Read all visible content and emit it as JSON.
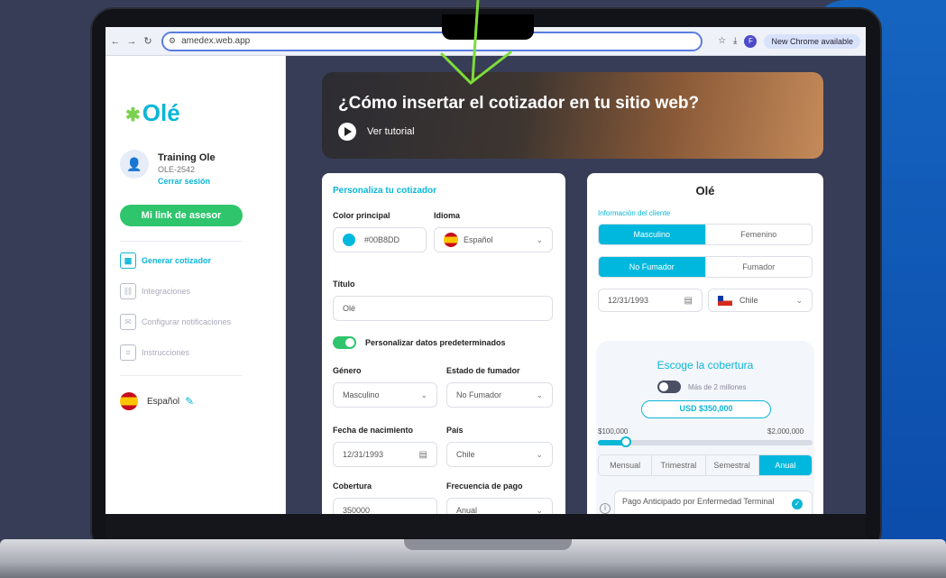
{
  "browser": {
    "url": "amedex.web.app",
    "update_label": "New Chrome available",
    "profile_initial": "F"
  },
  "sidebar": {
    "logo": "Olé",
    "user_name": "Training Ole",
    "user_id": "OLE-2542",
    "logout": "Cerrar sesión",
    "advisor_button": "Mi link de asesor",
    "items": [
      {
        "label": "Generar cotizador",
        "icon": "calculator-icon"
      },
      {
        "label": "Integraciones",
        "icon": "link-icon"
      },
      {
        "label": "Configurar notificaciones",
        "icon": "mail-icon"
      },
      {
        "label": "Instrucciones",
        "icon": "document-icon"
      }
    ],
    "language": "Español"
  },
  "hero": {
    "title": "¿Cómo insertar el cotizador en tu sitio web?",
    "tutorial": "Ver tutorial"
  },
  "form": {
    "section_title": "Personaliza tu cotizador",
    "color_label": "Color principal",
    "color_value": "#00B8DD",
    "language_label": "Idioma",
    "language_value": "Español",
    "title_label": "Título",
    "title_value": "Olé",
    "custom_defaults_label": "Personalizar datos predeterminados",
    "custom_defaults_enabled": true,
    "gender_label": "Género",
    "gender_value": "Masculino",
    "smoker_label": "Estado de fumador",
    "smoker_value": "No Fumador",
    "birthdate_label": "Fecha de nacimiento",
    "birthdate_value": "12/31/1993",
    "country_label": "País",
    "country_value": "Chile",
    "coverage_label": "Cobertura",
    "coverage_value": "350000",
    "frequency_label": "Frecuencia de pago",
    "frequency_value": "Anual"
  },
  "preview": {
    "title": "Olé",
    "client_info": "Información del cliente",
    "gender_options": [
      "Masculino",
      "Femenino"
    ],
    "gender_selected": "Masculino",
    "smoker_options": [
      "No Fumador",
      "Fumador"
    ],
    "smoker_selected": "No Fumador",
    "birthdate": "12/31/1993",
    "country": "Chile",
    "coverage_title": "Escoge la cobertura",
    "over_2m_label": "Más de 2 millones",
    "amount": "USD $350,000",
    "range_min": "$100,000",
    "range_max": "$2,000,000",
    "slider_fraction": 0.13,
    "frequencies": [
      "Mensual",
      "Trimestral",
      "Semestral",
      "Anual"
    ],
    "frequency_selected": "Anual",
    "benefit": "Pago Anticipado por Enfermedad Terminal"
  },
  "colors": {
    "accent": "#00B8DD",
    "green": "#2EC56C",
    "main_bg": "#383D57"
  }
}
